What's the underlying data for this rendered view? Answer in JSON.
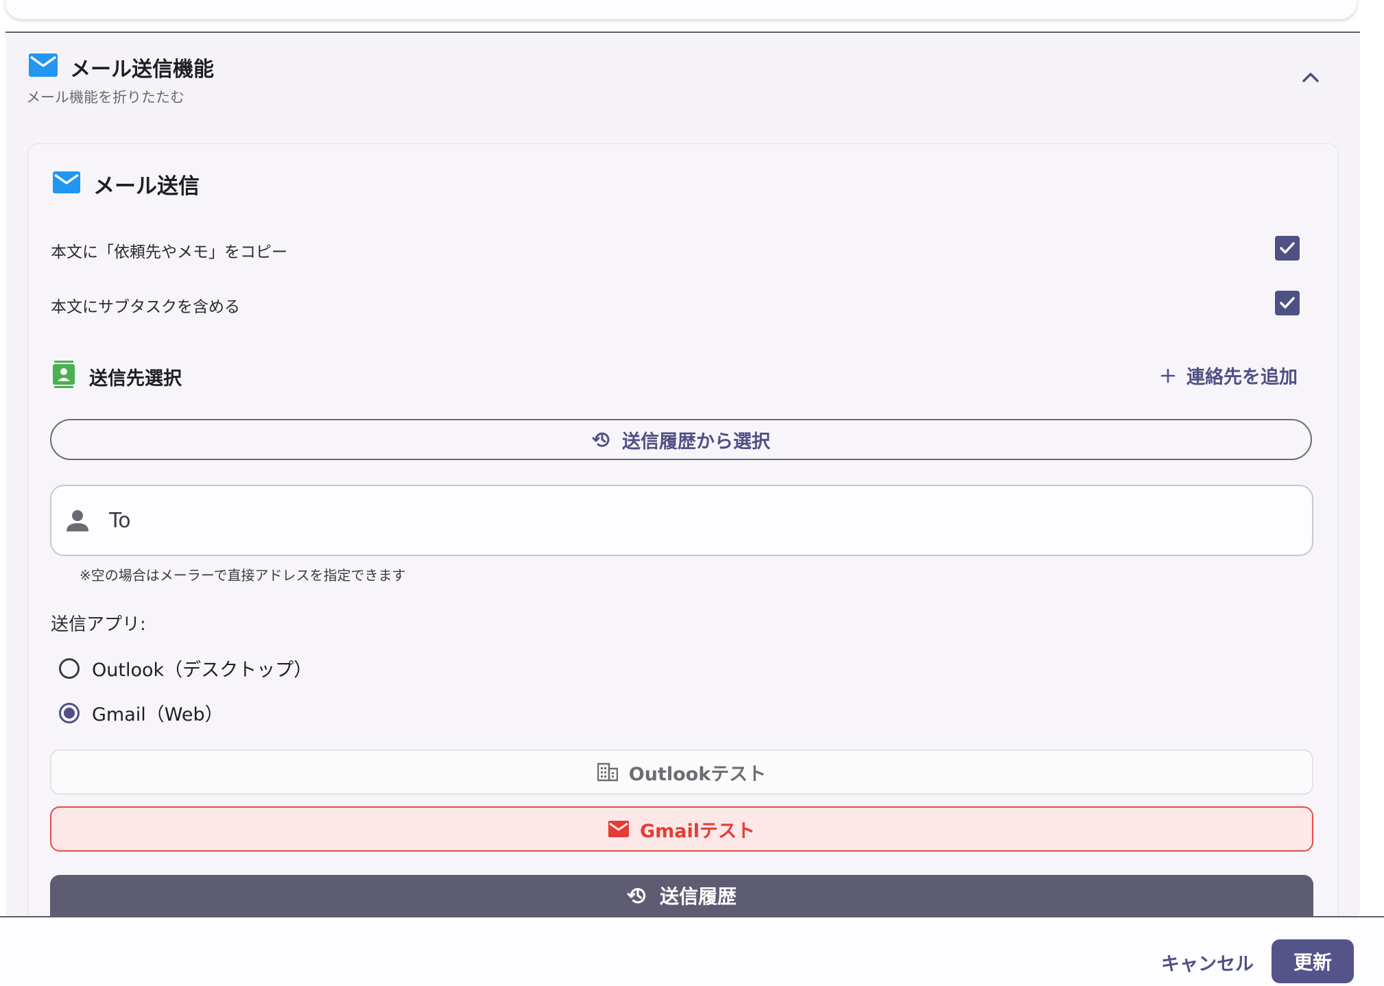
{
  "colors": {
    "accent": "#4f5184",
    "mail_icon": "#2196f3",
    "contact_icon": "#4caf50",
    "gmail_red": "#e53b34",
    "history_button": "#5e5c72"
  },
  "section": {
    "title": "メール送信機能",
    "subtitle": "メール機能を折りたたむ",
    "icon": "mail-icon",
    "collapse_icon": "chevron-up-icon"
  },
  "card": {
    "title": "メール送信",
    "options": [
      {
        "label": "本文に「依頼先やメモ」をコピー",
        "checked": true
      },
      {
        "label": "本文にサブタスクを含める",
        "checked": true
      }
    ]
  },
  "recipients": {
    "title": "送信先選択",
    "add_contact": "連絡先を追加",
    "history_select": "送信履歴から選択",
    "to_placeholder": "To",
    "hint": "※空の場合はメーラーで直接アドレスを指定できます"
  },
  "send_app": {
    "label": "送信アプリ:",
    "options": [
      {
        "label": "Outlook（デスクトップ）",
        "selected": false
      },
      {
        "label": "Gmail（Web）",
        "selected": true
      }
    ]
  },
  "buttons": {
    "outlook_test": "Outlookテスト",
    "gmail_test": "Gmailテスト",
    "send_history": "送信履歴"
  },
  "footer": {
    "cancel": "キャンセル",
    "update": "更新"
  }
}
